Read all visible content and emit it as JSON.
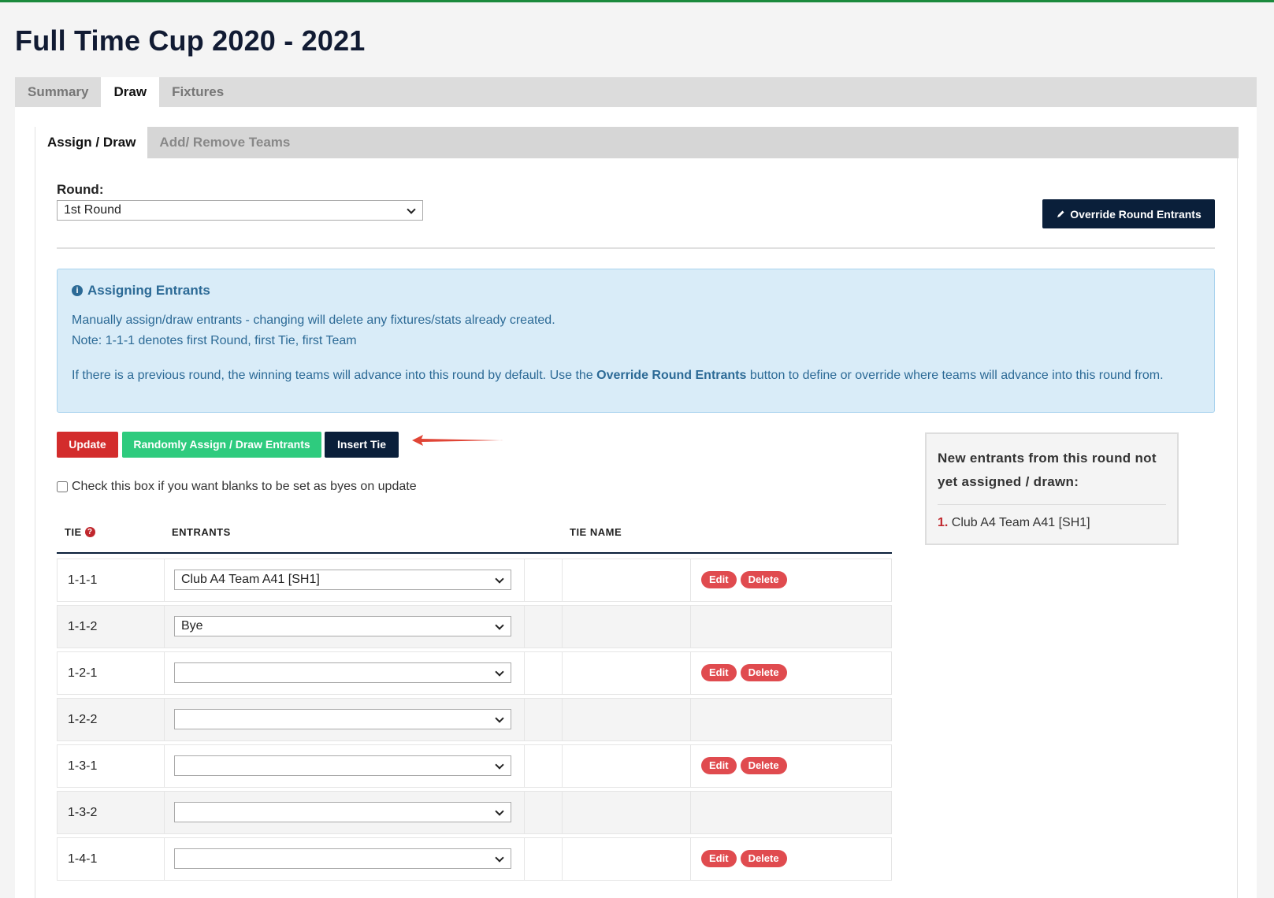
{
  "page_title": "Full Time Cup 2020 - 2021",
  "top_tabs": [
    {
      "label": "Summary",
      "active": false
    },
    {
      "label": "Draw",
      "active": true
    },
    {
      "label": "Fixtures",
      "active": false
    }
  ],
  "sub_tabs": [
    {
      "label": "Assign / Draw",
      "active": true
    },
    {
      "label": "Add/ Remove Teams",
      "active": false
    }
  ],
  "round": {
    "label": "Round:",
    "value": "1st Round"
  },
  "override_button": {
    "label": "Override Round Entrants",
    "icon": "pencil-icon"
  },
  "info": {
    "title": "Assigning Entrants",
    "icon": "info-icon",
    "line1": "Manually assign/draw entrants - changing will delete any fixtures/stats already created.",
    "line2": "Note: 1-1-1 denotes first Round, first Tie, first Team",
    "line3_pre": "If there is a previous round, the winning teams will advance into this round by default. Use the ",
    "line3_bold": "Override Round Entrants",
    "line3_post": " button to define or override where teams will advance into this round from."
  },
  "buttons": {
    "update": "Update",
    "random": "Randomly Assign / Draw Entrants",
    "insert_tie": "Insert Tie"
  },
  "bye_checkbox": {
    "label": "Check this box if you want blanks to be set as byes on update",
    "checked": false
  },
  "table": {
    "headers": {
      "tie": "TIE",
      "entrants": "ENTRANTS",
      "tie_name": "TIE NAME"
    },
    "edit_label": "Edit",
    "delete_label": "Delete",
    "rows": [
      {
        "tie": "1-1-1",
        "entrant": "Club A4 Team A41 [SH1]"
      },
      {
        "tie": "1-1-2",
        "entrant": "Bye"
      },
      {
        "tie": "1-2-1",
        "entrant": ""
      },
      {
        "tie": "1-2-2",
        "entrant": ""
      },
      {
        "tie": "1-3-1",
        "entrant": ""
      },
      {
        "tie": "1-3-2",
        "entrant": ""
      },
      {
        "tie": "1-4-1",
        "entrant": ""
      }
    ]
  },
  "side_panel": {
    "title": "New entrants from this round not yet assigned / drawn:",
    "items": [
      {
        "num": "1.",
        "label": "Club A4 Team A41 [SH1]"
      }
    ]
  },
  "colors": {
    "navy": "#0a1f3a",
    "update_red": "#d32c2c",
    "random_green": "#2ecb7e",
    "pill_red": "#e04b4f",
    "info_bg": "#d9ecf8",
    "top_border": "#1b8a3d"
  }
}
